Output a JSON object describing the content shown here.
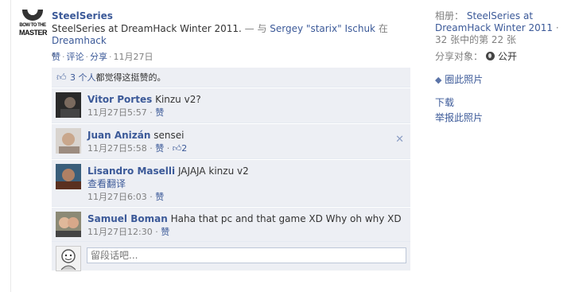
{
  "post": {
    "page_name": "SteelSeries",
    "logo_line1": "BOW TO THE",
    "logo_line2": "MASTER",
    "caption": "SteelSeries at DreamHack Winter 2011.",
    "with_prefix": " — 与 ",
    "tagged_user": "Sergey \"starix\" Ischuk",
    "at_word": " 在 ",
    "place": "Dreamhack",
    "dot": "。",
    "actions": {
      "like": "赞",
      "comment": "评论",
      "share": "分享",
      "date": "11月27日"
    }
  },
  "likes": {
    "count_text": "3 个人",
    "suffix": "都觉得这挺赞的。"
  },
  "comments": [
    {
      "name": "Vitor Portes",
      "text": "Kinzu v2?",
      "time": "11月27日5:57",
      "like": "赞"
    },
    {
      "name": "Juan Anizán",
      "text": "sensei",
      "time": "11月27日5:58",
      "like": "赞",
      "like_count": "2"
    },
    {
      "name": "Lisandro Maselli",
      "text": "JAJAJA kinzu v2",
      "translate": "查看翻译",
      "time": "11月27日6:03",
      "like": "赞"
    },
    {
      "name": "Samuel Boman",
      "text": "Haha that pc and that game XD Why oh why XD",
      "time": "11月27日12:30",
      "like": "赞"
    }
  ],
  "comment_input": {
    "placeholder": "留段话吧..."
  },
  "sidebar": {
    "album_label": "相册：",
    "album_name": "SteelSeries at DreamHack Winter 2011",
    "album_count": "· 32 张中的第 22 张",
    "share_label": "分享对象：",
    "privacy": "公开",
    "tag_photo": "圈此照片",
    "download": "下载",
    "report": "举报此照片"
  }
}
